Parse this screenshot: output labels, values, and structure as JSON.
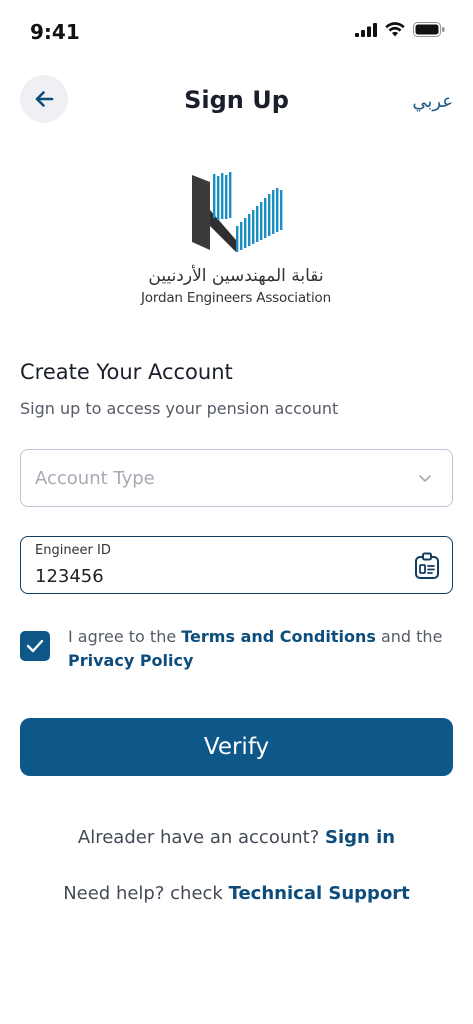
{
  "status_bar": {
    "time": "9:41"
  },
  "header": {
    "title": "Sign Up",
    "language_link": "عربي",
    "back_icon": "arrow-left-icon"
  },
  "logo": {
    "arabic_name": "نقابة المهندسين الأردنيين",
    "english_name": "Jordan Engineers Association",
    "colors": {
      "dark": "#3a3a3c",
      "accent": "#1a8fc4"
    }
  },
  "form": {
    "heading": "Create Your Account",
    "subheading": "Sign up to access your pension account",
    "account_type": {
      "placeholder": "Account Type",
      "value": ""
    },
    "engineer_id": {
      "label": "Engineer ID",
      "value": "123456",
      "icon": "id-card-icon"
    },
    "agreement": {
      "checked": true,
      "prefix": "I agree to the",
      "terms_link": "Terms and Conditions",
      "middle": "and the",
      "privacy_link": "Privacy Policy"
    },
    "submit_label": "Verify"
  },
  "footer": {
    "signin_prompt": "Alreader have an account?",
    "signin_link": "Sign in",
    "help_prompt": "Need help? check",
    "help_link": "Technical Support"
  },
  "colors": {
    "primary": "#0d5889",
    "link": "#0d4d7c",
    "border": "#b9c6d4"
  }
}
